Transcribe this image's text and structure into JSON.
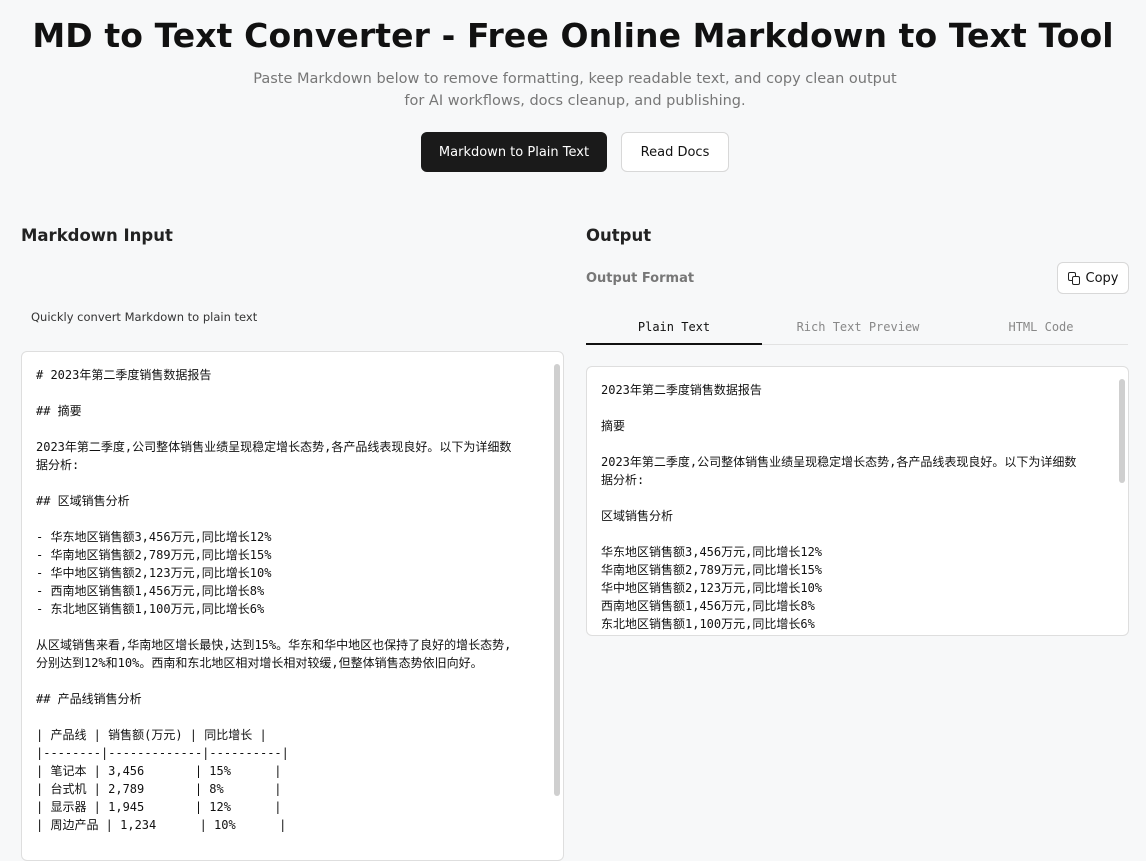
{
  "header": {
    "title": "MD to Text Converter - Free Online Markdown to Text Tool",
    "subtitle": "Paste Markdown below to remove formatting, keep readable text, and copy clean output for AI workflows, docs cleanup, and publishing.",
    "primary_button": "Markdown to Plain Text",
    "secondary_button": "Read Docs"
  },
  "input": {
    "heading": "Markdown Input",
    "hint": "Quickly convert Markdown to plain text",
    "content": "# 2023年第二季度销售数据报告\n\n## 摘要\n\n2023年第二季度,公司整体销售业绩呈现稳定增长态势,各产品线表现良好。以下为详细数据分析:\n\n## 区域销售分析\n\n- 华东地区销售额3,456万元,同比增长12%\n- 华南地区销售额2,789万元,同比增长15%\n- 华中地区销售额2,123万元,同比增长10%\n- 西南地区销售额1,456万元,同比增长8%\n- 东北地区销售额1,100万元,同比增长6%\n\n从区域销售来看,华南地区增长最快,达到15%。华东和华中地区也保持了良好的增长态势,分别达到12%和10%。西南和东北地区相对增长相对较缓,但整体销售态势依旧向好。\n\n## 产品线销售分析\n\n| 产品线 | 销售额(万元) | 同比增长 |\n|--------|-------------|----------|\n| 笔记本 | 3,456       | 15%      |\n| 台式机 | 2,789       | 8%       |\n| 显示器 | 1,945       | 12%      |\n| 周边产品 | 1,234      | 10%      |"
  },
  "output": {
    "heading": "Output",
    "format_label": "Output Format",
    "copy_label": "Copy",
    "tabs": [
      "Plain Text",
      "Rich Text Preview",
      "HTML Code"
    ],
    "active_tab": "Plain Text",
    "content": "2023年第二季度销售数据报告\n\n摘要\n\n2023年第二季度,公司整体销售业绩呈现稳定增长态势,各产品线表现良好。以下为详细数据分析:\n\n区域销售分析\n\n华东地区销售额3,456万元,同比增长12%\n华南地区销售额2,789万元,同比增长15%\n华中地区销售额2,123万元,同比增长10%\n西南地区销售额1,456万元,同比增长8%\n东北地区销售额1,100万元,同比增长6%"
  }
}
